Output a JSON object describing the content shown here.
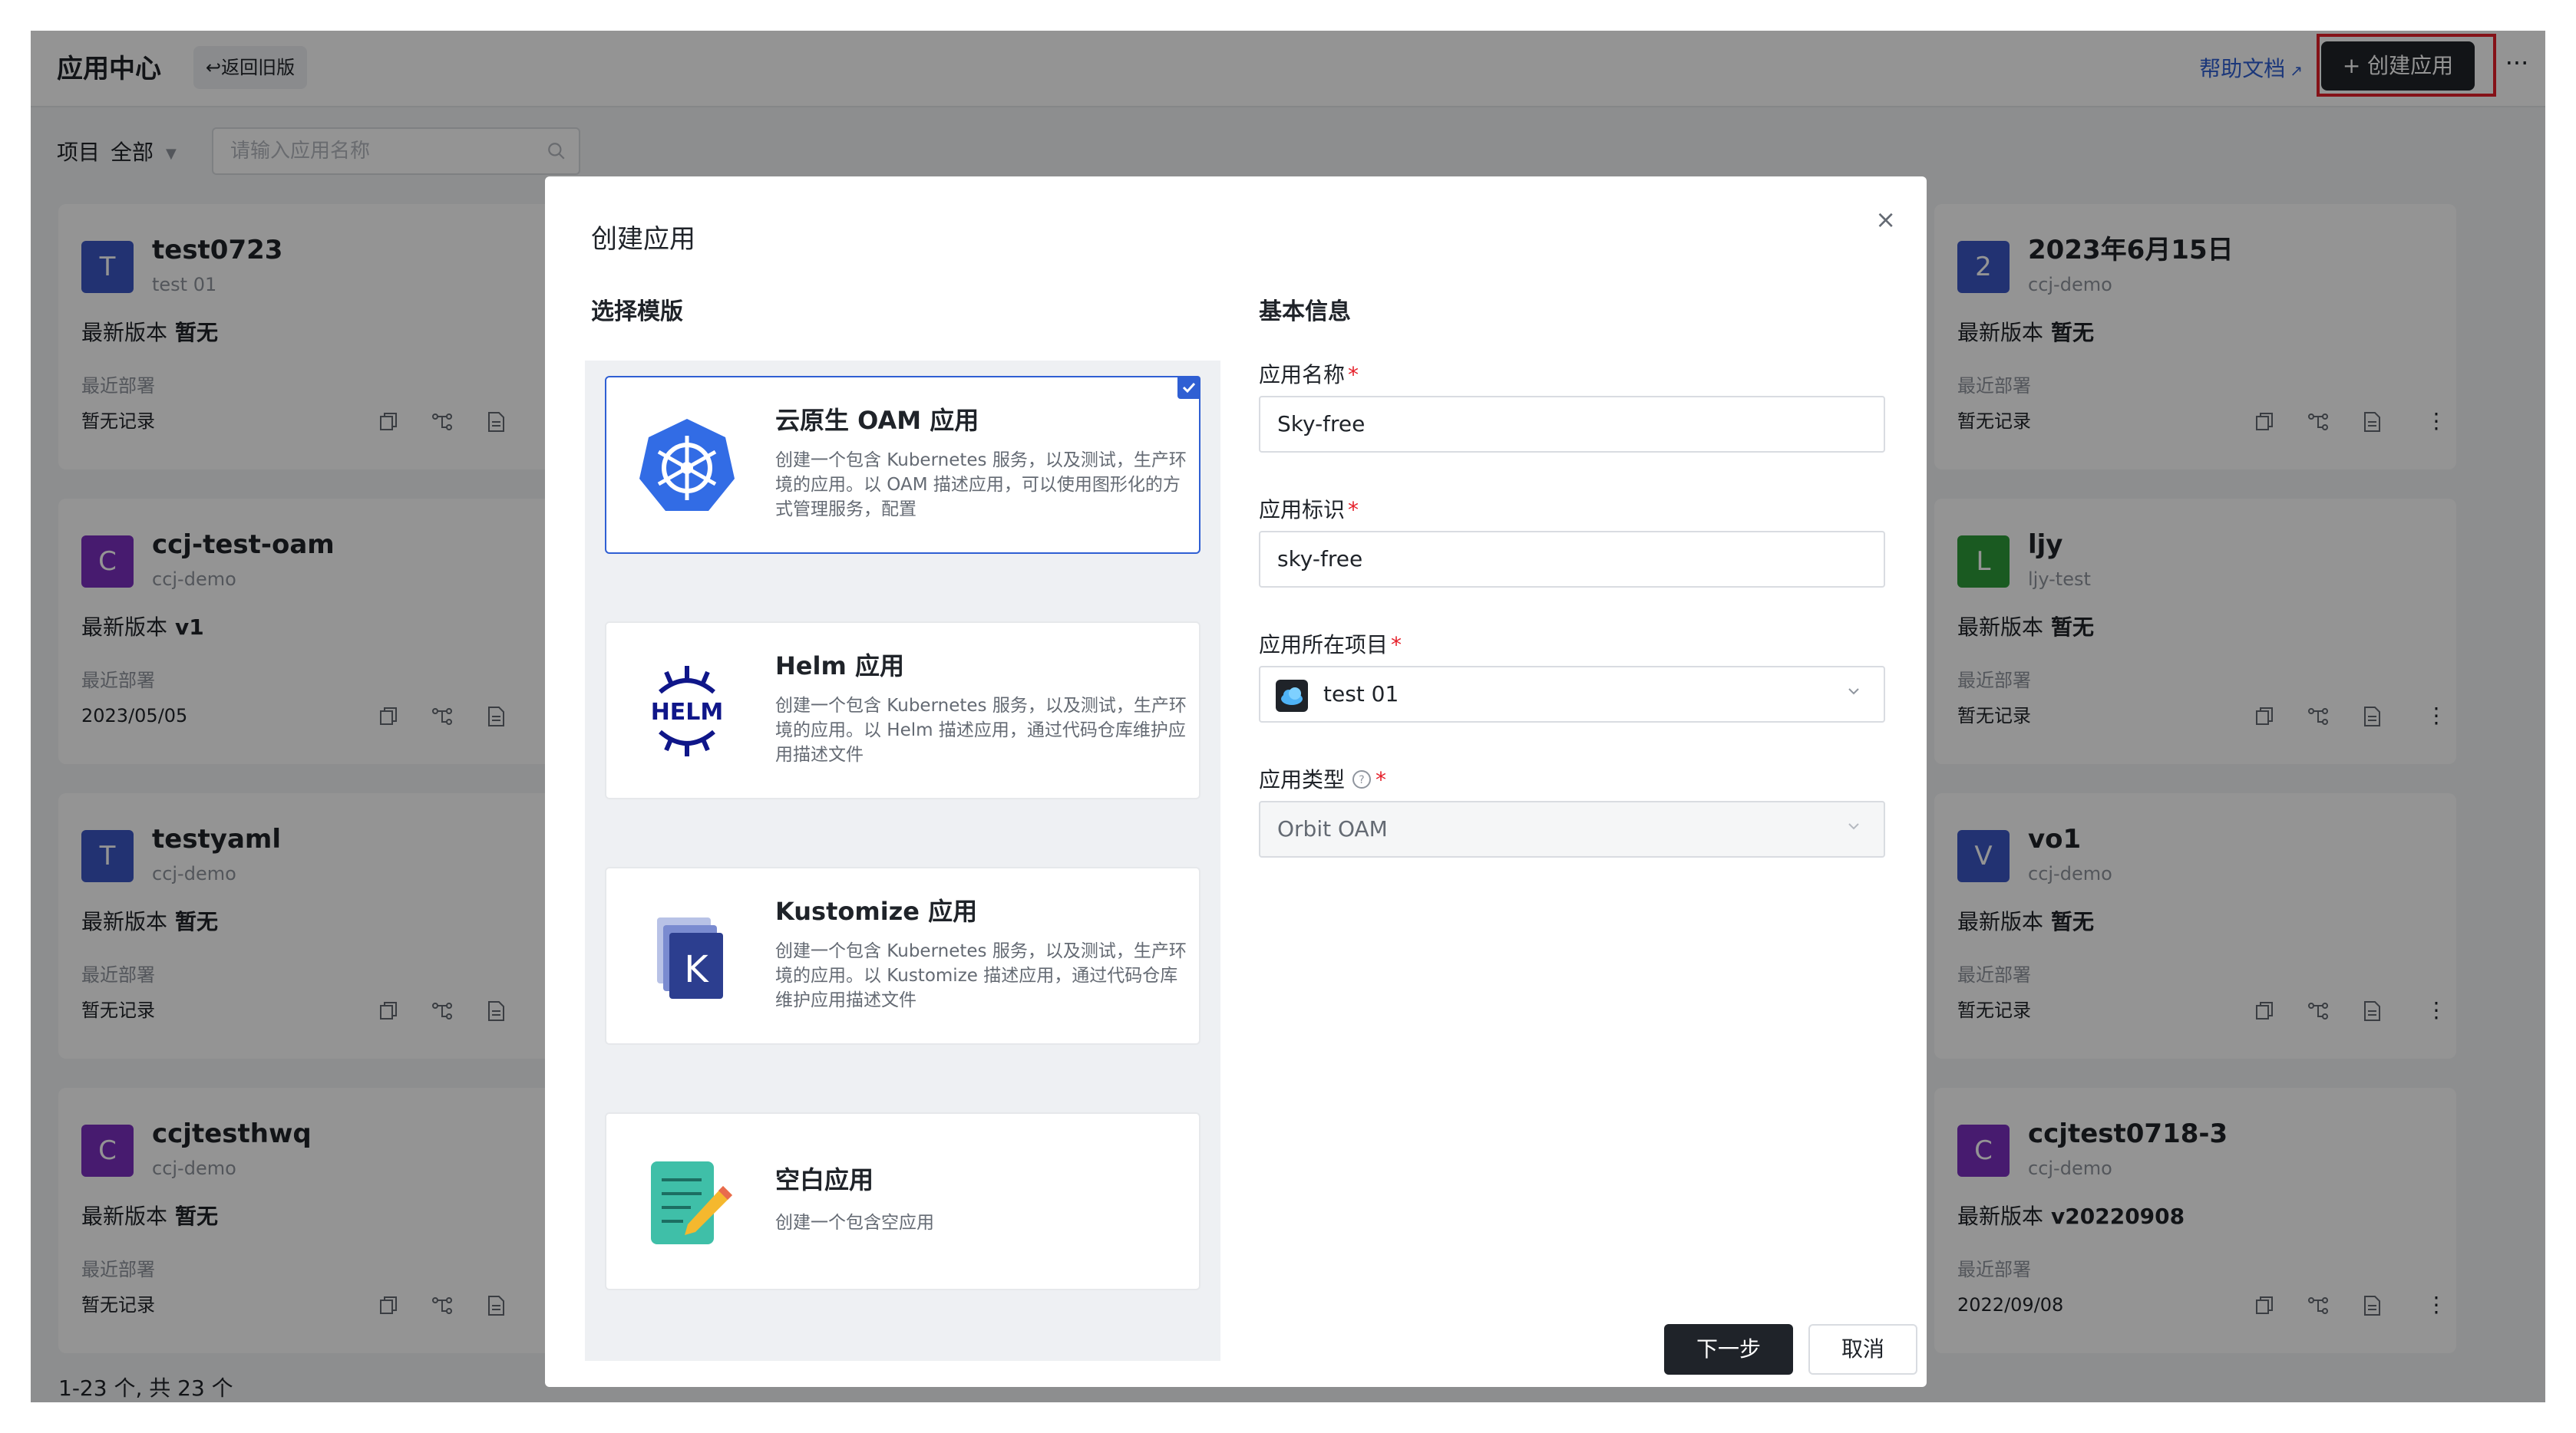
{
  "header": {
    "title": "应用中心",
    "back_label": "↩返回旧版",
    "help_label": "帮助文档",
    "create_label": "+ 创建应用",
    "more_label": "···"
  },
  "filter": {
    "project_label": "项目",
    "project_value": "全部",
    "search_placeholder": "请输入应用名称"
  },
  "cards_left": [
    {
      "initial": "T",
      "color": "#3b57c4",
      "name": "test0723",
      "project": "test 01",
      "version_label": "最新版本",
      "version": "暂无",
      "deploy_label": "最近部署",
      "deploy": "暂无记录"
    },
    {
      "initial": "C",
      "color": "#7b2fbf",
      "name": "ccj-test-oam",
      "project": "ccj-demo",
      "version_label": "最新版本",
      "version": "v1",
      "deploy_label": "最近部署",
      "deploy": "2023/05/05"
    },
    {
      "initial": "T",
      "color": "#3b57c4",
      "name": "testyaml",
      "project": "ccj-demo",
      "version_label": "最新版本",
      "version": "暂无",
      "deploy_label": "最近部署",
      "deploy": "暂无记录"
    },
    {
      "initial": "C",
      "color": "#7b2fbf",
      "name": "ccjtesthwq",
      "project": "ccj-demo",
      "version_label": "最新版本",
      "version": "暂无",
      "deploy_label": "最近部署",
      "deploy": "暂无记录"
    }
  ],
  "cards_right": [
    {
      "initial": "2",
      "color": "#3b57c4",
      "name": "2023年6月15日",
      "project": "ccj-demo",
      "version_label": "最新版本",
      "version": "暂无",
      "deploy_label": "最近部署",
      "deploy": "暂无记录"
    },
    {
      "initial": "L",
      "color": "#2e9c3a",
      "name": "ljy",
      "project": "ljy-test",
      "version_label": "最新版本",
      "version": "暂无",
      "deploy_label": "最近部署",
      "deploy": "暂无记录"
    },
    {
      "initial": "V",
      "color": "#3b57c4",
      "name": "vo1",
      "project": "ccj-demo",
      "version_label": "最新版本",
      "version": "暂无",
      "deploy_label": "最近部署",
      "deploy": "暂无记录"
    },
    {
      "initial": "C",
      "color": "#7b2fbf",
      "name": "ccjtest0718-3",
      "project": "ccj-demo",
      "version_label": "最新版本",
      "version": "v20220908",
      "deploy_label": "最近部署",
      "deploy": "2022/09/08"
    }
  ],
  "pager": "1-23 个, 共 23 个",
  "modal": {
    "title": "创建应用",
    "close": "×",
    "template_section": "选择模版",
    "info_section": "基本信息",
    "templates": [
      {
        "name": "云原生 OAM 应用",
        "desc": "创建一个包含 Kubernetes 服务，以及测试，生产环境的应用。以 OAM 描述应用，可以使用图形化的方式管理服务，配置",
        "icon": "kubernetes-icon",
        "selected": true
      },
      {
        "name": "Helm 应用",
        "desc": "创建一个包含 Kubernetes 服务，以及测试，生产环境的应用。以 Helm 描述应用，通过代码仓库维护应用描述文件",
        "icon": "helm-icon",
        "selected": false
      },
      {
        "name": "Kustomize 应用",
        "desc": "创建一个包含 Kubernetes 服务，以及测试，生产环境的应用。以 Kustomize 描述应用，通过代码仓库维护应用描述文件",
        "icon": "kustomize-icon",
        "selected": false
      },
      {
        "name": "空白应用",
        "desc": "创建一个包含空应用",
        "icon": "blank-app-icon",
        "selected": false
      }
    ],
    "fields": {
      "name_label": "应用名称",
      "name_value": "Sky-free",
      "id_label": "应用标识",
      "id_value": "sky-free",
      "project_label": "应用所在项目",
      "project_value": "test 01",
      "type_label": "应用类型",
      "type_value": "Orbit OAM",
      "required_mark": "*"
    },
    "next_label": "下一步",
    "cancel_label": "取消"
  },
  "colors": {
    "accent": "#2f5fd3",
    "dark_button": "#1f2329",
    "required": "#e5202a",
    "highlight_outline": "#e5202a"
  }
}
